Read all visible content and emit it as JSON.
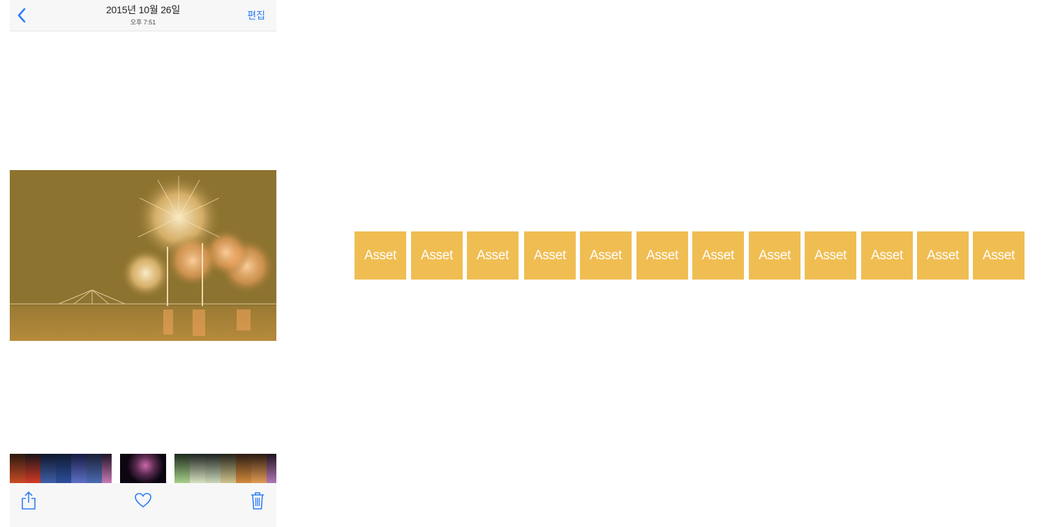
{
  "navbar": {
    "title": "2015년 10월 26일",
    "subtitle": "오후 7:51",
    "edit_label": "편집",
    "back_icon": "chevron-left-icon"
  },
  "colors": {
    "accent": "#2f7df6",
    "asset_fill": "#f0bd52",
    "photo_tint": "#8d7330",
    "bar_bg": "#f7f7f8"
  },
  "toolbar": {
    "share_icon": "share-icon",
    "favorite_icon": "heart-icon",
    "delete_icon": "trash-icon"
  },
  "assets": [
    {
      "label": "Asset"
    },
    {
      "label": "Asset"
    },
    {
      "label": "Asset"
    },
    {
      "label": "Asset"
    },
    {
      "label": "Asset"
    },
    {
      "label": "Asset"
    },
    {
      "label": "Asset"
    },
    {
      "label": "Asset"
    },
    {
      "label": "Asset"
    },
    {
      "label": "Asset"
    },
    {
      "label": "Asset"
    },
    {
      "label": "Asset"
    }
  ]
}
